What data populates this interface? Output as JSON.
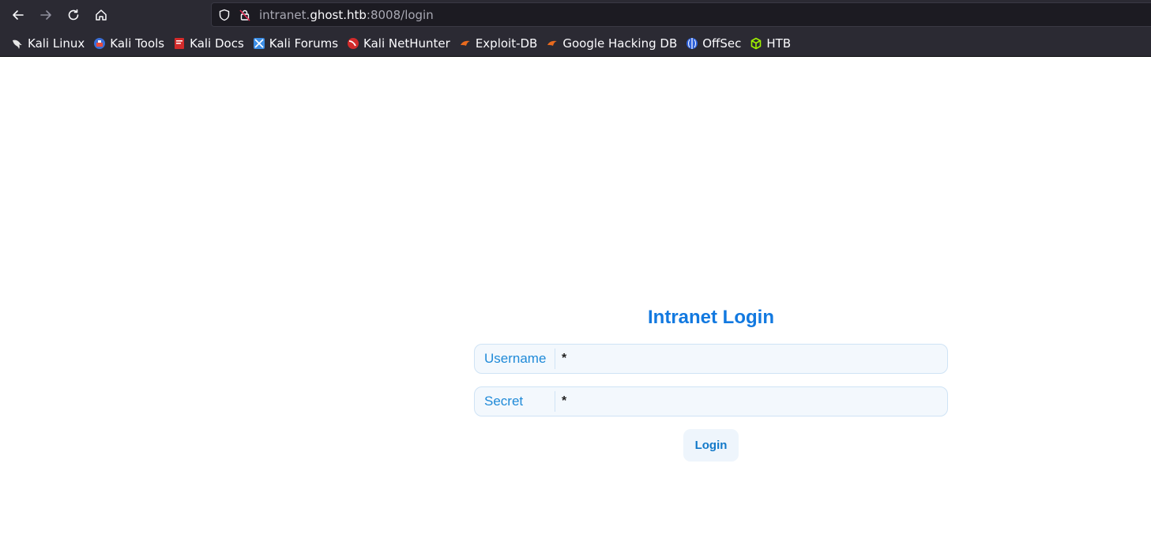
{
  "browser": {
    "url": {
      "prefix": "intranet.",
      "host": "ghost.htb",
      "suffix": ":8008/login"
    },
    "icons": {
      "back": "arrow-left-icon",
      "forward": "arrow-right-icon",
      "reload": "reload-icon",
      "home": "home-icon",
      "tracking": "shield-icon",
      "security": "lock-insecure-icon"
    }
  },
  "bookmarks": [
    {
      "label": "Kali Linux",
      "icon": "kali-dragon-icon"
    },
    {
      "label": "Kali Tools",
      "icon": "kali-tools-icon"
    },
    {
      "label": "Kali Docs",
      "icon": "kali-docs-icon"
    },
    {
      "label": "Kali Forums",
      "icon": "kali-forums-icon"
    },
    {
      "label": "Kali NetHunter",
      "icon": "nethunter-icon"
    },
    {
      "label": "Exploit-DB",
      "icon": "exploitdb-icon"
    },
    {
      "label": "Google Hacking DB",
      "icon": "ghdb-icon"
    },
    {
      "label": "OffSec",
      "icon": "offsec-icon"
    },
    {
      "label": "HTB",
      "icon": "htb-cube-icon"
    }
  ],
  "login": {
    "title": "Intranet Login",
    "username_label": "Username",
    "username_placeholder": "*",
    "secret_label": "Secret",
    "secret_placeholder": "*",
    "submit_label": "Login"
  },
  "colors": {
    "accent": "#1279e0",
    "field_bg": "#f3f8fd",
    "chrome_bg": "#2b2a33"
  }
}
